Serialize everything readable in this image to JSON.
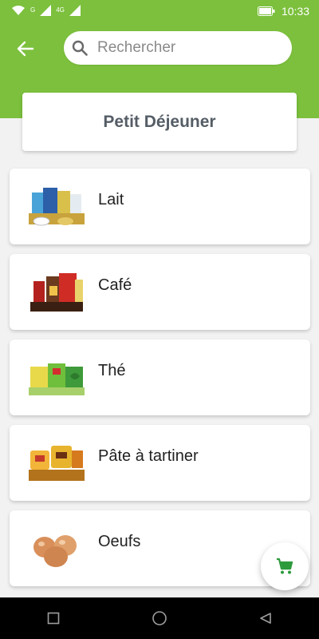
{
  "status_bar": {
    "time": "10:33",
    "signal_g": "G",
    "signal_4g": "4G",
    "icons": [
      "wifi-icon",
      "signal-icon",
      "signal-icon",
      "battery-icon"
    ]
  },
  "header": {
    "back_icon": "arrow-left-icon",
    "search": {
      "placeholder": "Rechercher",
      "value": "",
      "icon": "search-icon"
    }
  },
  "page": {
    "title": "Petit Déjeuner"
  },
  "categories": [
    {
      "label": "Lait",
      "icon": "milk-products-image"
    },
    {
      "label": "Café",
      "icon": "coffee-products-image"
    },
    {
      "label": "Thé",
      "icon": "tea-products-image"
    },
    {
      "label": "Pâte à tartiner",
      "icon": "spread-products-image"
    },
    {
      "label": "Oeufs",
      "icon": "eggs-image"
    }
  ],
  "fab": {
    "icon": "cart-icon"
  },
  "navbar": {
    "icons": [
      "recent-apps-icon",
      "home-icon",
      "back-triangle-icon"
    ]
  },
  "colors": {
    "brand_green": "#7cc03d",
    "cart_green": "#2d9a3c",
    "title_text": "#555d66"
  }
}
